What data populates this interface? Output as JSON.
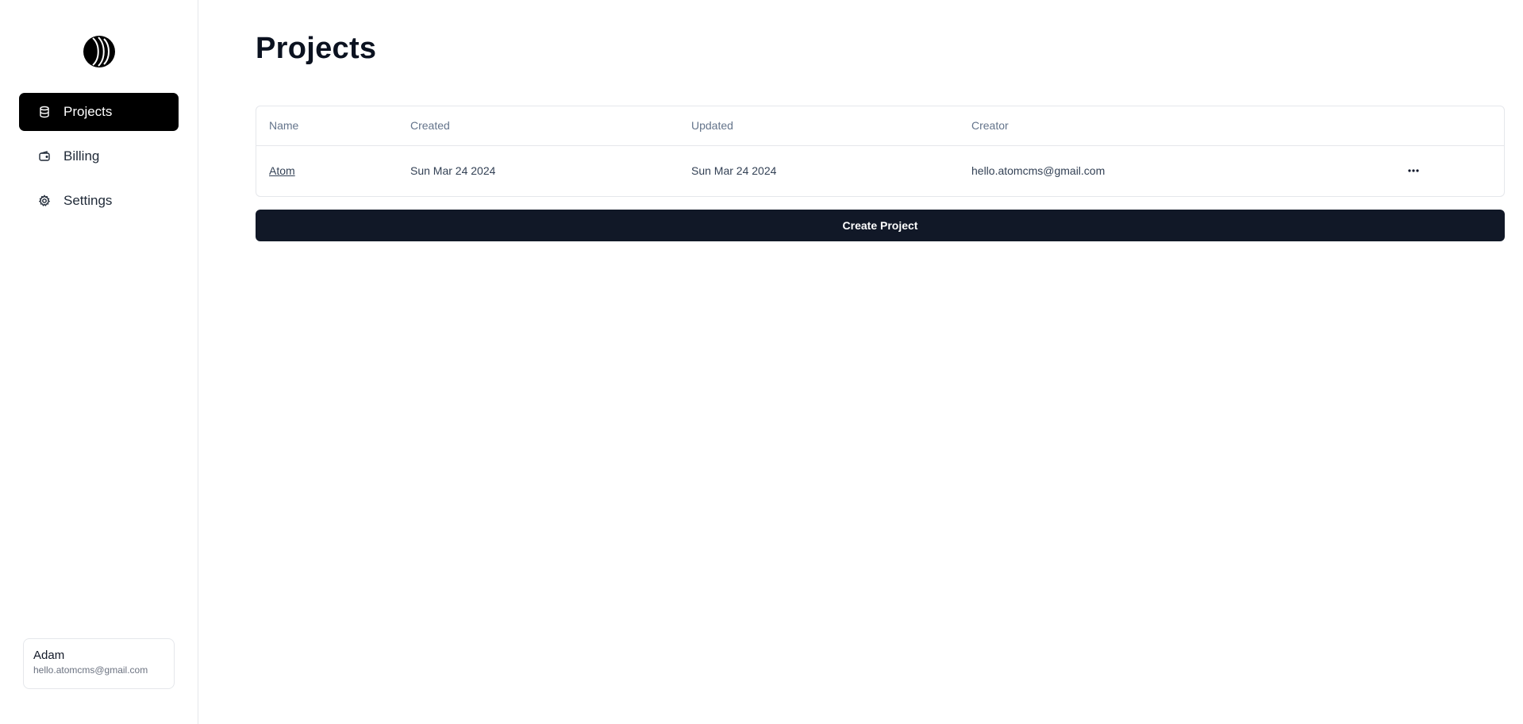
{
  "sidebar": {
    "logo_icon": "atom-logo-icon",
    "items": [
      {
        "label": "Projects",
        "icon": "database-icon",
        "active": true
      },
      {
        "label": "Billing",
        "icon": "wallet-icon",
        "active": false
      },
      {
        "label": "Settings",
        "icon": "gear-icon",
        "active": false
      }
    ],
    "user": {
      "name": "Adam",
      "email": "hello.atomcms@gmail.com"
    }
  },
  "main": {
    "title": "Projects",
    "table": {
      "columns": [
        "Name",
        "Created",
        "Updated",
        "Creator"
      ],
      "rows": [
        {
          "name": "Atom",
          "created": "Sun Mar 24 2024",
          "updated": "Sun Mar 24 2024",
          "creator": "hello.atomcms@gmail.com",
          "actions_icon": "more-horizontal-icon"
        }
      ]
    },
    "create_button_label": "Create Project"
  },
  "colors": {
    "active_nav_bg": "#000000",
    "primary_button_bg": "#111827",
    "border": "#e5e7eb",
    "muted_text": "#64748b"
  }
}
